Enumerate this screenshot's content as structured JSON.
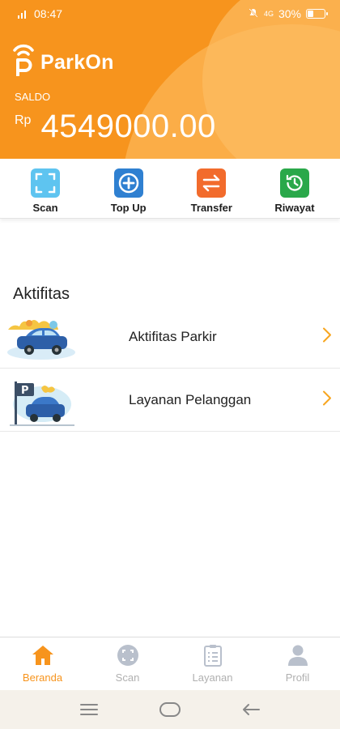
{
  "status_bar": {
    "time": "08:47",
    "battery": "30%",
    "battery_level": 0.3
  },
  "app": {
    "name": "ParkOn",
    "balance_label": "SALDO",
    "currency": "Rp",
    "balance": "4549000.00"
  },
  "colors": {
    "primary": "#f7941d",
    "scan_icon": "#5ec4f0",
    "topup_icon": "#2f80d1",
    "transfer_icon": "#f26b2c",
    "history_icon": "#2aa84a"
  },
  "quick_actions": [
    {
      "label": "Scan",
      "icon": "scan-frame-icon"
    },
    {
      "label": "Top Up",
      "icon": "plus-circle-icon"
    },
    {
      "label": "Transfer",
      "icon": "swap-arrows-icon"
    },
    {
      "label": "Riwayat",
      "icon": "history-clock-icon"
    }
  ],
  "aktifitas": {
    "title": "Aktifitas",
    "items": [
      {
        "label": "Aktifitas Parkir",
        "icon": "parked-car-illustration"
      },
      {
        "label": "Layanan Pelanggan",
        "icon": "parking-service-illustration"
      }
    ]
  },
  "bottom_nav": [
    {
      "label": "Beranda",
      "icon": "home-icon",
      "active": true
    },
    {
      "label": "Scan",
      "icon": "scan-icon",
      "active": false
    },
    {
      "label": "Layanan",
      "icon": "clipboard-icon",
      "active": false
    },
    {
      "label": "Profil",
      "icon": "profile-icon",
      "active": false
    }
  ],
  "system_nav": [
    "menu-icon",
    "home-outline-icon",
    "back-arrow-icon"
  ]
}
